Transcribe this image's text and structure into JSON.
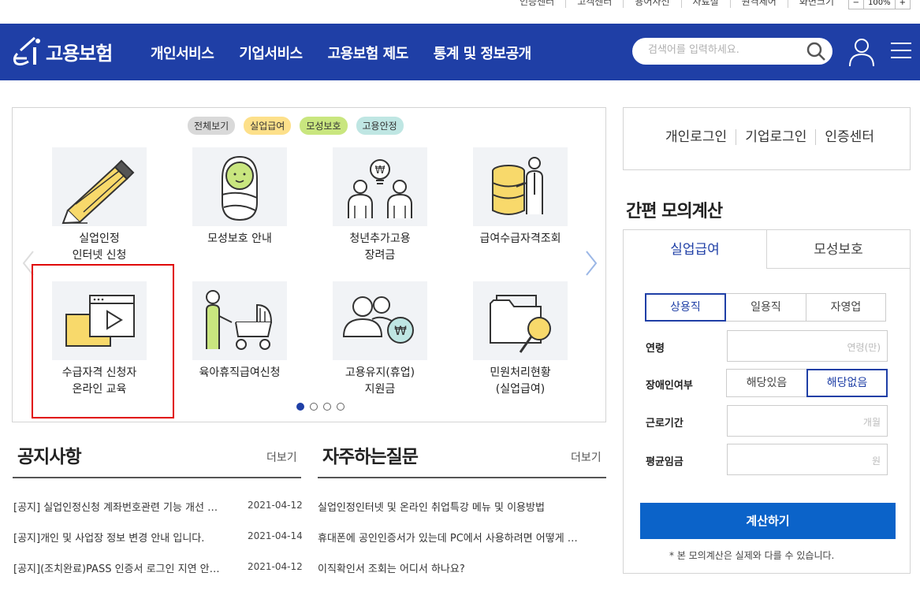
{
  "util_links": [
    "인증센터",
    "고객센터",
    "용어사전",
    "자료실",
    "원격제어",
    "화면크기"
  ],
  "zoom": {
    "minus": "−",
    "level": "100%",
    "plus": "+"
  },
  "brand": {
    "name": "고용보험",
    "color": "#1f3fa6"
  },
  "gnb": [
    "개인서비스",
    "기업서비스",
    "고용보험 제도",
    "통계 및 정보공개"
  ],
  "search": {
    "placeholder": "검색어를 입력하세요."
  },
  "filters": [
    {
      "label": "전체보기",
      "color": "#d9d9d9"
    },
    {
      "label": "실업급여",
      "color": "#fde08a"
    },
    {
      "label": "모성보호",
      "color": "#c9e67f"
    },
    {
      "label": "고용안정",
      "color": "#bfe6e3"
    }
  ],
  "services": [
    {
      "line1": "실업인정",
      "line2": "인터넷 신청",
      "icon": "pencil-icon"
    },
    {
      "line1": "모성보호 안내",
      "line2": "",
      "icon": "baby-icon"
    },
    {
      "line1": "청년추가고용",
      "line2": "장려금",
      "icon": "youth-employment-icon"
    },
    {
      "line1": "급여수급자격조회",
      "line2": "",
      "icon": "coin-stack-person-icon"
    },
    {
      "line1": "수급자격 신청자",
      "line2": "온라인 교육",
      "icon": "video-play-icon"
    },
    {
      "line1": "육아휴직급여신청",
      "line2": "",
      "icon": "stroller-icon"
    },
    {
      "line1": "고용유지(휴업)",
      "line2": "지원금",
      "icon": "people-coin-icon"
    },
    {
      "line1": "민원처리현황",
      "line2": "(실업급여)",
      "icon": "folder-search-icon"
    }
  ],
  "notice": {
    "title": "공지사항",
    "more": "더보기",
    "items": [
      {
        "text": "[공지] 실업인정신청 계좌번호관련 기능 개선 …",
        "date": "2021-04-12"
      },
      {
        "text": "[공지]개인 및 사업장 정보 변경 안내 입니다.",
        "date": "2021-04-14"
      },
      {
        "text": "[공지](조치완료)PASS 인증서 로그인 지연 안…",
        "date": "2021-04-12"
      }
    ]
  },
  "faq": {
    "title": "자주하는질문",
    "more": "더보기",
    "items": [
      "실업인정인터넷 및 온라인 취업특강 메뉴 및 이용방법",
      "휴대폰에 공인인증서가 있는데 PC에서 사용하려면 어떻게 …",
      "이직확인서 조회는 어디서 하나요?"
    ]
  },
  "login_links": [
    "개인로그인",
    "기업로그인",
    "인증센터"
  ],
  "calc": {
    "title": "간편 모의계산",
    "tabs": [
      "실업급여",
      "모성보호"
    ],
    "job_types": [
      "상용직",
      "일용직",
      "자영업"
    ],
    "age_label": "연령",
    "age_unit": "연령(만)",
    "disability_label": "장애인여부",
    "disability_options": [
      "해당있음",
      "해당없음"
    ],
    "period_label": "근로기간",
    "period_unit": "개월",
    "wage_label": "평균임금",
    "wage_unit": "원",
    "button": "계산하기",
    "note": "* 본 모의계산은 실제와 다를 수 있습니다."
  }
}
